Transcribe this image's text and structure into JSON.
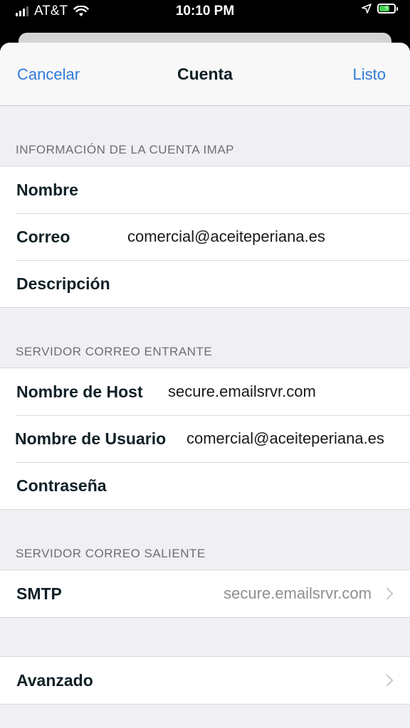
{
  "status_bar": {
    "carrier": "AT&T",
    "time": "10:10 PM",
    "battery_color": "#3fd14f"
  },
  "nav": {
    "cancel_label": "Cancelar",
    "title": "Cuenta",
    "done_label": "Listo",
    "accent_color": "#2f7ad8"
  },
  "account_info": {
    "header": "INFORMACIÓN DE LA CUENTA IMAP",
    "name_label": "Nombre",
    "name_value": "",
    "email_label": "Correo",
    "email_value": "comercial@aceiteperiana.es",
    "description_label": "Descripción",
    "description_value": ""
  },
  "incoming": {
    "header": "SERVIDOR CORREO ENTRANTE",
    "host_label": "Nombre de Host",
    "host_value": "secure.emailsrvr.com",
    "user_label": "Nombre de Usuario",
    "user_value": "comercial@aceiteperiana.es",
    "password_label": "Contraseña",
    "password_value": ""
  },
  "outgoing": {
    "header": "SERVIDOR CORREO SALIENTE",
    "smtp_label": "SMTP",
    "smtp_value": "secure.emailsrvr.com"
  },
  "advanced": {
    "label": "Avanzado"
  }
}
